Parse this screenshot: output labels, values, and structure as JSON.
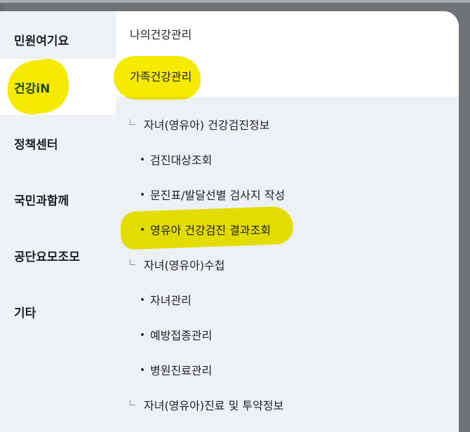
{
  "sidebar": {
    "items": [
      {
        "label": "민원여기요",
        "active": false
      },
      {
        "label": "건강iN",
        "active": true
      },
      {
        "label": "정책센터",
        "active": false
      },
      {
        "label": "국민과함께",
        "active": false
      },
      {
        "label": "공단요모조모",
        "active": false
      },
      {
        "label": "기타",
        "active": false
      }
    ]
  },
  "submenu": {
    "my_health": "나의건강관리",
    "family_health": "가족건강관리",
    "child_checkup": {
      "label": "자녀(영유아) 건강검진정보",
      "items": [
        "검진대상조회",
        "문진표/발달선별 검사지 작성",
        "영유아 건강검진 결과조회"
      ]
    },
    "child_handbook": {
      "label": "자녀(영유아)수첩",
      "items": [
        "자녀관리",
        "예방접종관리",
        "병원진료관리"
      ]
    },
    "child_treatment": {
      "label": "자녀(영유아)진료 및 투약정보"
    }
  },
  "colors": {
    "active_text": "#1f4fbf",
    "highlighter": "#f5ea00",
    "sidebar_bg": "#eef1f6",
    "submenu_bg": "#edf0f5"
  }
}
